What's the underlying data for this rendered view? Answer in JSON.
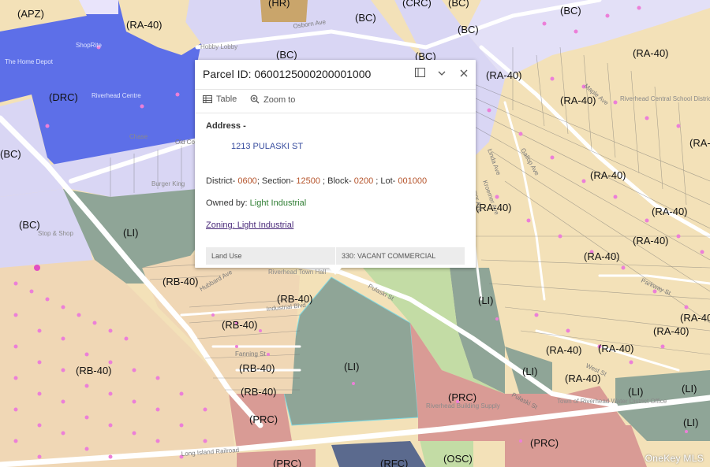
{
  "map": {
    "zones": [
      "(APZ)",
      "(HR)",
      "(CRC)",
      "(BC)",
      "(BC)",
      "(RA-40)",
      "(RA-40)",
      "(BC)",
      "(BC)",
      "(BC)",
      "(DRC)",
      "(RA-40)",
      "(BC)",
      "(RA-40)",
      "(RA-40)",
      "(BC)",
      "(LI)",
      "(RB-40)",
      "(RA-40)",
      "(RA-40)",
      "(RA-40)",
      "(RA-40)",
      "(RB-40)",
      "(RB-40)",
      "(RB-40)",
      "(RB-40)",
      "(RB-40)",
      "(LI)",
      "(LI)",
      "(LI)",
      "(RA-40)",
      "(RA-40)",
      "(RA-40)",
      "(RA-40)",
      "(RA-40)",
      "(LI)",
      "(LI)",
      "(PRC)",
      "(PRC)",
      "(PRC)",
      "(PRC)",
      "(RFC)",
      "(OSC)",
      "(LI)"
    ],
    "streets": [
      "Osborn Ave",
      "Old Co",
      "Pulaski St",
      "Pulaski St",
      "Long Island Railroad",
      "Fanning St",
      "Parkway St",
      "Linda Ave",
      "Kroemer Ave",
      "Maple Ave",
      "Gallop Ave",
      "Raynor Ave",
      "Industrial Blvd",
      "Hubbard Ave",
      "West St"
    ],
    "poi": [
      "Hobby Lobby",
      "ShopRite",
      "The Home Depot",
      "Riverhead Centre",
      "Chase",
      "Stop & Shop",
      "Riverhead Central School District Administration Building",
      "Riverhead Building Supply",
      "Town of Riverhead Water District Office",
      "Riverhead Town Hall",
      "Burger King"
    ]
  },
  "popup": {
    "title": "Parcel ID: 0600125000200001000",
    "actions": {
      "table": "Table",
      "zoom": "Zoom to"
    },
    "address_label": "Address -",
    "address": "1213 PULASKI ST",
    "district": {
      "p1": "District- ",
      "district": "0600",
      "p2": "; Section- ",
      "section": "12500",
      "p3": " ; Block- ",
      "block": "0200",
      "p4": " ; Lot- ",
      "lot": "001000"
    },
    "owned_prefix": "Owned by: ",
    "owned_value": "Light Industrial",
    "zoning": "Zoning: Light Industrial",
    "land_use_key": "Land Use",
    "land_use_value": "330: VACANT COMMERCIAL",
    "icons": [
      "dock-icon",
      "chevron-down-icon",
      "close-icon",
      "table-icon",
      "zoom-icon"
    ]
  },
  "watermark": "OneKey MLS",
  "colors": {
    "ra40": "#f3e1b8",
    "rb40": "#f0d7b5",
    "bc": "#d9d6f4",
    "drc": "#5d6fe8",
    "li": "#8fa597",
    "prc": "#d99b95",
    "osc": "#c3dca5",
    "hr": "#c9a56b",
    "apz": "#f3e1b8",
    "dots": "#ec7fd8"
  }
}
